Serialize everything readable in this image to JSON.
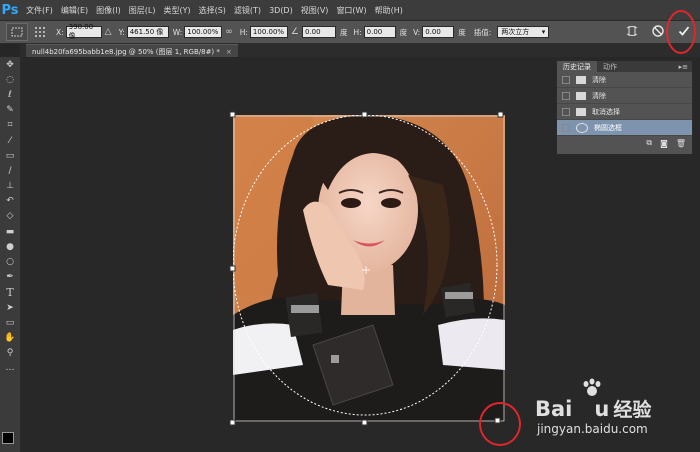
{
  "menubar": {
    "logo": "Ps",
    "items": [
      "文件(F)",
      "编辑(E)",
      "图像(I)",
      "图层(L)",
      "类型(Y)",
      "选择(S)",
      "滤镜(T)",
      "3D(D)",
      "视图(V)",
      "窗口(W)",
      "帮助(H)"
    ]
  },
  "options": {
    "x_label": "X:",
    "x_value": "390.00 像",
    "y_label": "Y:",
    "y_value": "461.50 像",
    "w_label": "W:",
    "w_value": "100.00%",
    "h_label": "H:",
    "h_value": "100.00%",
    "angle_value": "0.00",
    "angle_unit": "度",
    "hskew_label": "H:",
    "hskew_value": "0.00",
    "hskew_unit": "度",
    "vskew_label": "V:",
    "vskew_value": "0.00",
    "vskew_unit": "度",
    "interp_label": "插值:",
    "interp_value": "两次立方"
  },
  "document": {
    "tab_title": "null4b20fa695babb1e8.jpg @ 50% (图层 1, RGB/8#) *",
    "close": "×"
  },
  "history": {
    "tab_history": "历史记录",
    "tab_actions": "动作",
    "menu": "▸≡",
    "items": [
      {
        "label": "清除"
      },
      {
        "label": "清除"
      },
      {
        "label": "取消选择"
      },
      {
        "label": "椭圆选框"
      }
    ]
  },
  "watermark": {
    "brand": "Bai",
    "brand2": "u",
    "jingyan": "经验",
    "url": "jingyan.baidu.com"
  },
  "colors": {
    "highlight_circle": "#e0262a",
    "ps_blue": "#31a8ff",
    "selected_row": "#7e93ad"
  },
  "tools": [
    "move-icon",
    "elliptical-marquee-icon",
    "lasso-icon",
    "quick-select-icon",
    "crop-icon",
    "eyedropper-icon",
    "healing-brush-icon",
    "brush-icon",
    "clone-stamp-icon",
    "history-brush-icon",
    "eraser-icon",
    "gradient-icon",
    "blur-icon",
    "dodge-icon",
    "pen-icon",
    "type-icon",
    "path-select-icon",
    "rectangle-icon",
    "hand-icon",
    "zoom-icon",
    "more-icon"
  ]
}
